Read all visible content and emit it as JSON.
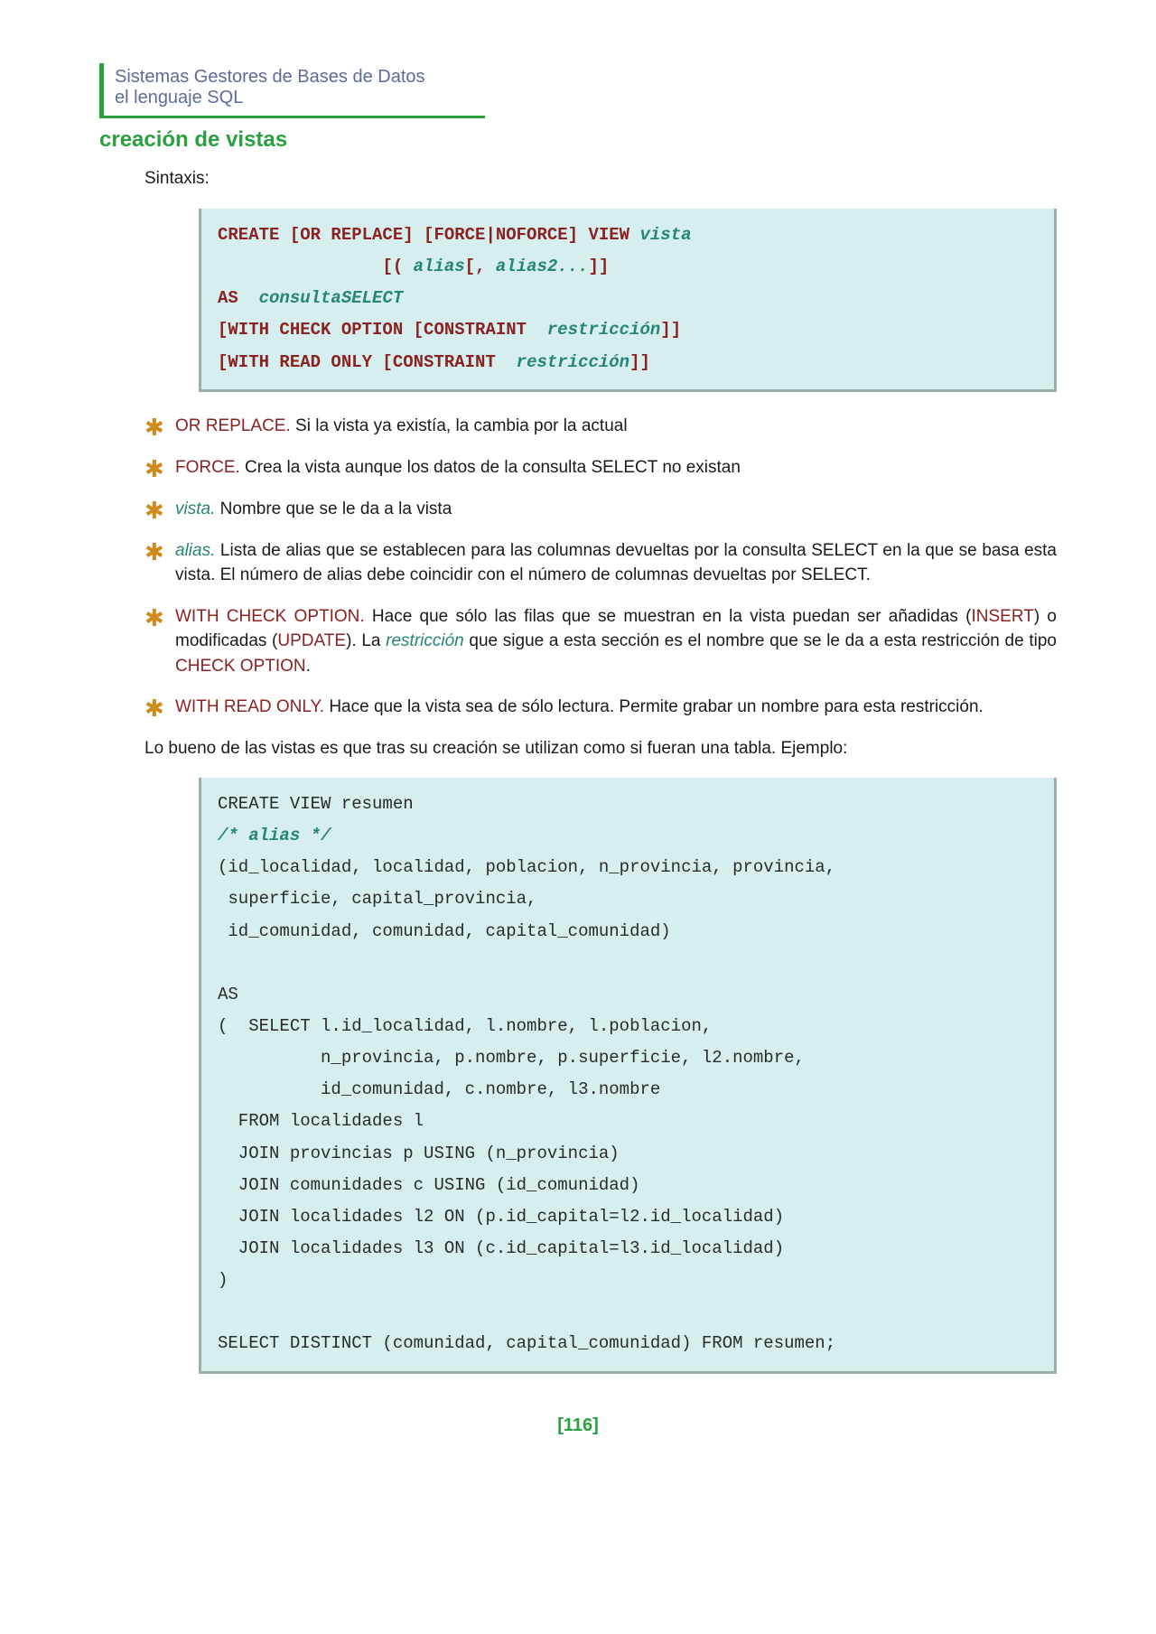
{
  "header": {
    "line1": "Sistemas Gestores de Bases de Datos",
    "line2": "el lenguaje SQL"
  },
  "section_title": "creación de vistas",
  "syntax_label": "Sintaxis:",
  "syntax_block": {
    "code": [
      {
        "kw": "CREATE [OR REPLACE] [FORCE|NOFORCE] VIEW",
        "ident": "vista"
      },
      {
        "indent": "                ",
        "kw": "[(",
        "ident": "alias",
        "kw2": "[,",
        "ident2": " alias2...",
        "kw3": "]]"
      },
      {
        "kw": "AS",
        "ident": " consultaSELECT"
      },
      {
        "kw": "[WITH CHECK OPTION [CONSTRAINT",
        "ident": " restricción",
        "kw2": "]]"
      },
      {
        "kw": "[WITH READ ONLY [CONSTRAINT",
        "ident": " restricción",
        "kw2": "]]"
      }
    ]
  },
  "bullets": [
    {
      "term": "OR REPLACE.",
      "term_style": "brown",
      "text": " Si la vista ya existía, la cambia por la actual"
    },
    {
      "term": "FORCE.",
      "term_style": "brown",
      "text": " Crea la vista aunque los datos de la consulta SELECT no existan"
    },
    {
      "term": "vista.",
      "term_style": "teal",
      "text": " Nombre que se le da a la vista"
    },
    {
      "term": "alias.",
      "term_style": "teal",
      "text": " Lista de alias que se establecen para las columnas devueltas por la consulta SELECT en la que se basa esta vista. El número de alias debe coincidir con el número de columnas devueltas por SELECT."
    },
    {
      "term": "WITH CHECK OPTION.",
      "term_style": "brown",
      "text_parts": [
        {
          "t": "  Hace que sólo las filas que se muestran en la vista puedan ser añadidas ("
        },
        {
          "t": "INSERT",
          "style": "brown"
        },
        {
          "t": ") o modificadas ("
        },
        {
          "t": "UPDATE",
          "style": "brown"
        },
        {
          "t": "). La "
        },
        {
          "t": "restricción ",
          "style": "teal"
        },
        {
          "t": " que sigue a esta sección es el nombre que se le da a esta restricción de tipo "
        },
        {
          "t": "CHECK OPTION",
          "style": "brown"
        },
        {
          "t": "."
        }
      ]
    },
    {
      "term": "WITH READ ONLY.",
      "term_style": "brown",
      "text": " Hace que la vista sea de sólo lectura. Permite grabar un nombre para esta restricción."
    }
  ],
  "bodytext1": "Lo bueno de las vistas es que tras su creación se utilizan como si fueran una tabla. Ejemplo:",
  "example_code": [
    "CREATE VIEW resumen",
    {
      "comment": "/* alias */"
    },
    "(id_localidad, localidad, poblacion, n_provincia, provincia,",
    " superficie, capital_provincia,",
    " id_comunidad, comunidad, capital_comunidad)",
    "",
    "AS",
    "(  SELECT l.id_localidad, l.nombre, l.poblacion,",
    "          n_provincia, p.nombre, p.superficie, l2.nombre,",
    "          id_comunidad, c.nombre, l3.nombre",
    "  FROM localidades l",
    "  JOIN provincias p USING (n_provincia)",
    "  JOIN comunidades c USING (id_comunidad)",
    "  JOIN localidades l2 ON (p.id_capital=l2.id_localidad)",
    "  JOIN localidades l3 ON (c.id_capital=l3.id_localidad)",
    ")",
    "",
    "SELECT DISTINCT (comunidad, capital_comunidad) FROM resumen;"
  ],
  "page_number": "[116]"
}
